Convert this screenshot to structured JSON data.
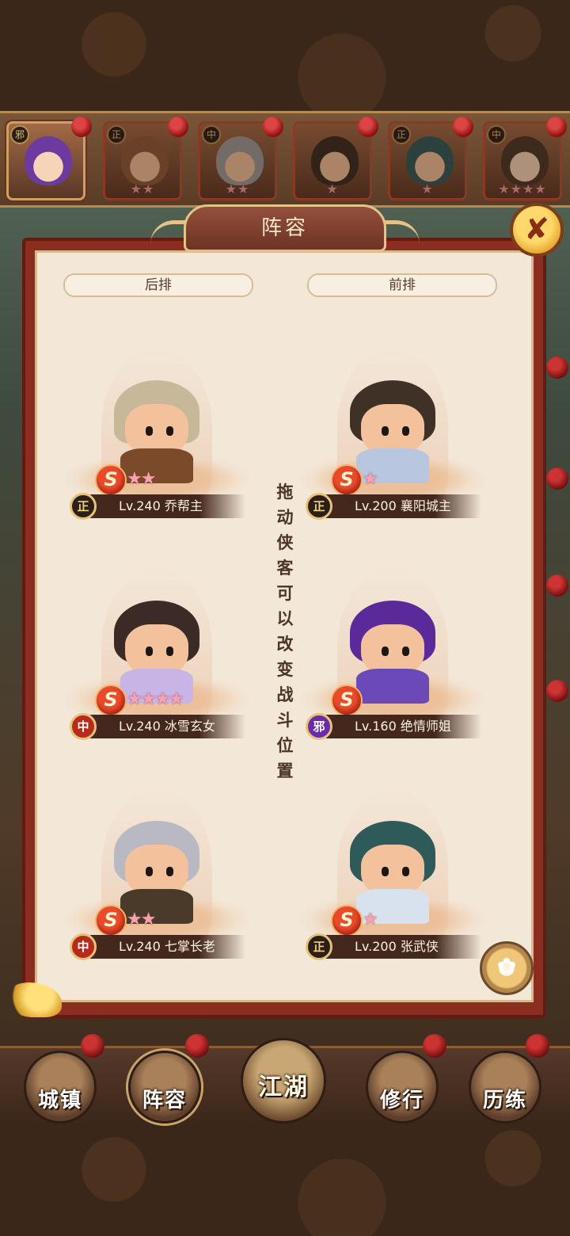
{
  "panel": {
    "title": "阵容",
    "close_icon": "close-icon",
    "back_row_label": "后排",
    "front_row_label": "前排",
    "hint": "拖动侠客可以改变战斗位置"
  },
  "roster": [
    {
      "faction": "邪",
      "stars": "",
      "selected": true
    },
    {
      "faction": "正",
      "stars": "★★",
      "selected": false
    },
    {
      "faction": "中",
      "stars": "★★",
      "selected": false
    },
    {
      "faction": "",
      "stars": "★",
      "selected": false
    },
    {
      "faction": "正",
      "stars": "★",
      "selected": false
    },
    {
      "faction": "中",
      "stars": "★★★★",
      "selected": false
    }
  ],
  "heroes": {
    "back": [
      {
        "faction": "正",
        "level_name": "Lv.240 乔帮主",
        "stars": "★★",
        "rank": "S"
      },
      {
        "faction": "中",
        "level_name": "Lv.240 冰雪玄女",
        "stars": "★★★★",
        "rank": "S"
      },
      {
        "faction": "中",
        "level_name": "Lv.240 七掌长老",
        "stars": "★★",
        "rank": "S"
      }
    ],
    "front": [
      {
        "faction": "正",
        "level_name": "Lv.200 襄阳城主",
        "stars": "★",
        "rank": "S"
      },
      {
        "faction": "邪",
        "level_name": "Lv.160 绝情师姐",
        "stars": "",
        "rank": "S"
      },
      {
        "faction": "正",
        "level_name": "Lv.200 张武侠",
        "stars": "★",
        "rank": "S"
      }
    ]
  },
  "nav": [
    {
      "label": "城镇",
      "icon": "town-icon"
    },
    {
      "label": "阵容",
      "icon": "lineup-icon",
      "active": true
    },
    {
      "label": "江湖",
      "icon": "jianghu-scroll-icon"
    },
    {
      "label": "修行",
      "icon": "cultivation-icon"
    },
    {
      "label": "历练",
      "icon": "training-icon"
    }
  ],
  "colors": {
    "panel_frame": "#8c2e1f",
    "panel_paper": "#f3e7d8",
    "faction_zheng": "#2b1f17",
    "faction_zhong": "#b82a1a",
    "faction_xie": "#6b2aa8",
    "star": "#f5a3b0"
  }
}
